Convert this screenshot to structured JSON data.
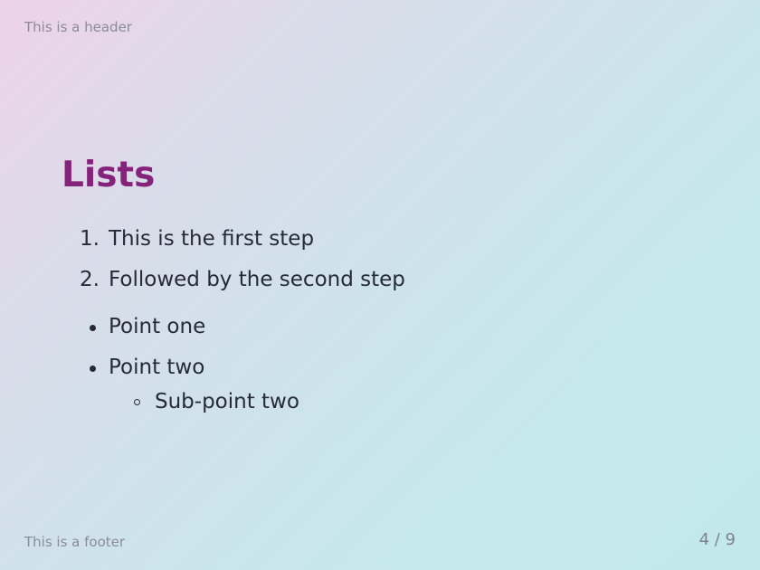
{
  "slide": {
    "header": "This is a header",
    "title": "Lists",
    "ordered_items": [
      {
        "number": "1.",
        "text": "This is the first step"
      },
      {
        "number": "2.",
        "text": "Followed by the second step"
      }
    ],
    "bullet_items": [
      {
        "text": "Point one"
      },
      {
        "text": "Point two",
        "sub_items": [
          {
            "text": "Sub-point two"
          }
        ]
      }
    ],
    "footer": "This is a footer",
    "page_number": "4 / 9"
  },
  "colors": {
    "title": "#85237a",
    "body_text": "#252a36",
    "muted_text": "#8a8d96"
  }
}
